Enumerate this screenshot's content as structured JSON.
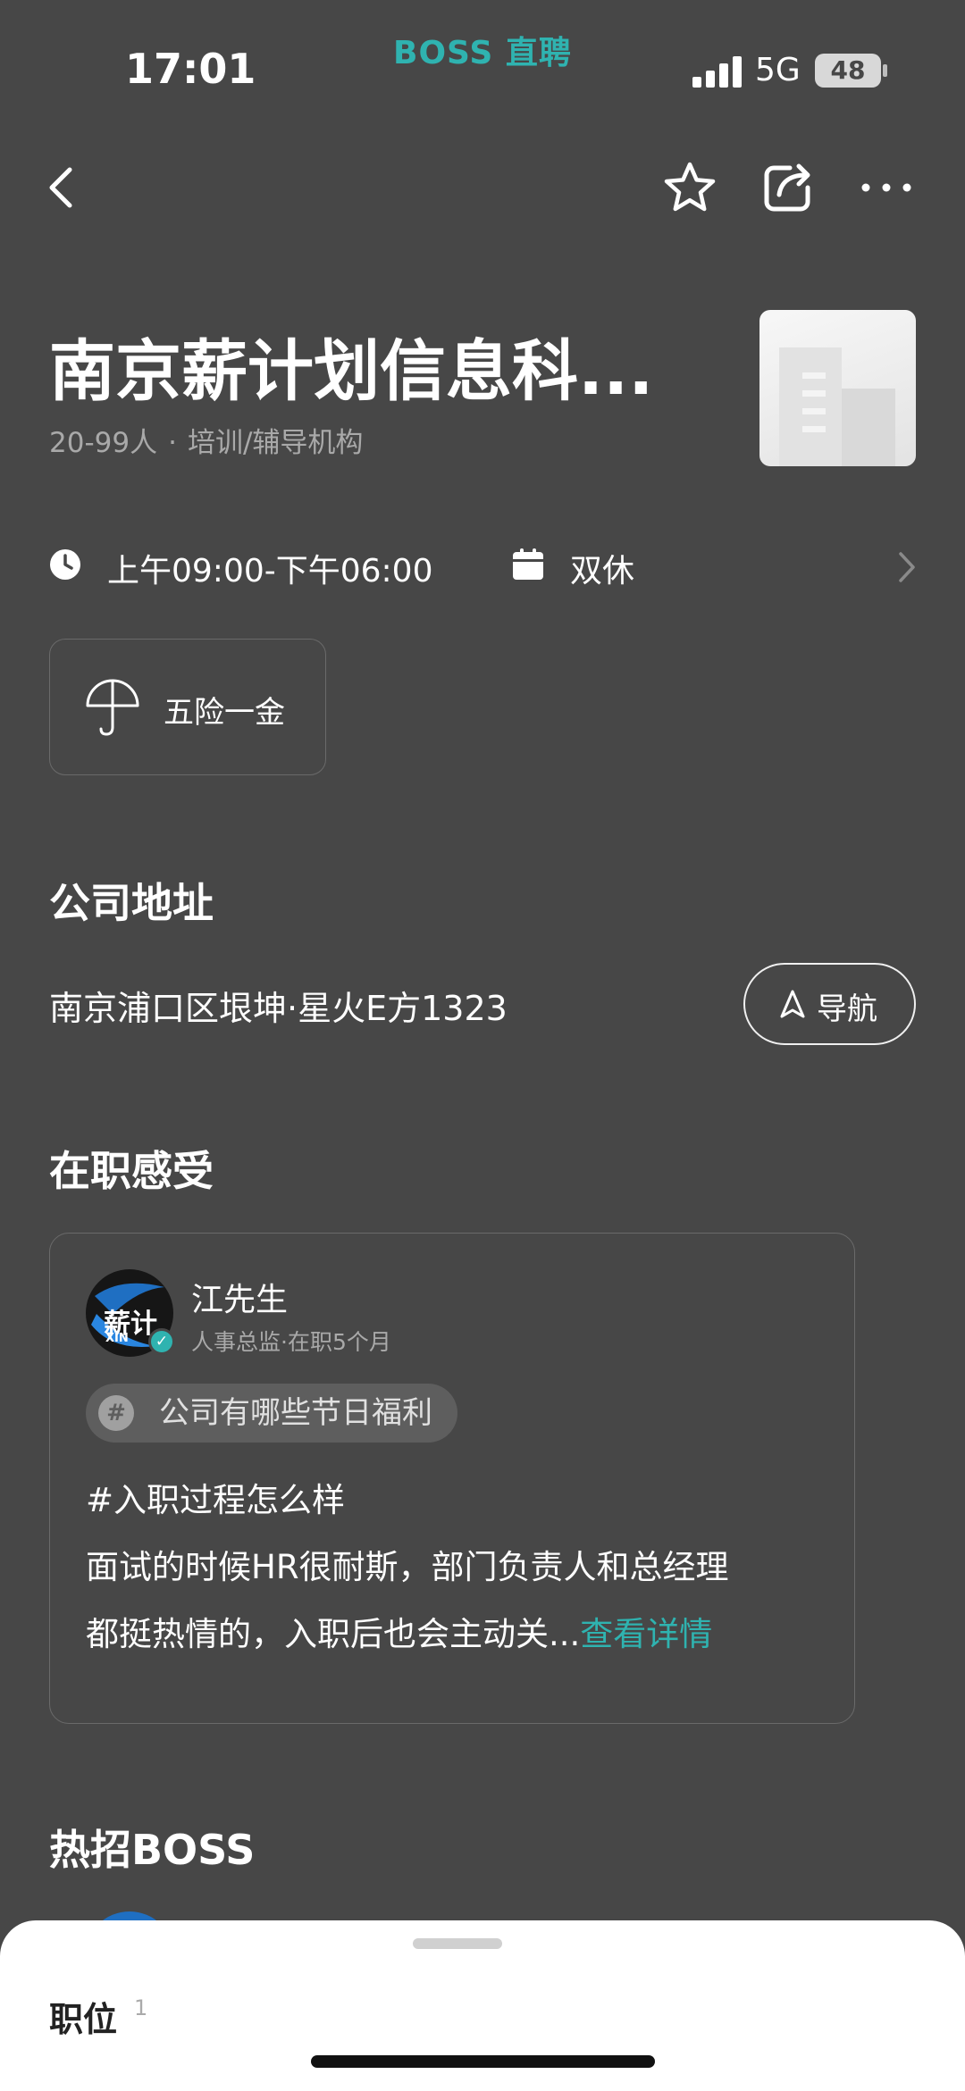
{
  "status_bar": {
    "time": "17:01",
    "app_badge": "BOSS 直聘",
    "network": "5G",
    "battery": "48"
  },
  "nav": {
    "back_icon": "chevron-left-icon",
    "favorite_icon": "star-icon",
    "share_icon": "share-icon",
    "more_icon": "more-icon"
  },
  "company": {
    "name": "南京薪计划信息科...",
    "size": "20-99人",
    "separator": "·",
    "industry": "培训/辅导机构"
  },
  "schedule": {
    "hours": "上午09:00-下午06:00",
    "rest": "双休"
  },
  "benefits": [
    {
      "label": "五险一金",
      "icon": "umbrella-icon"
    }
  ],
  "address_section": {
    "title": "公司地址",
    "address": "南京浦口区垠坤·星火E方1323",
    "nav_button": "导航"
  },
  "reviews_section": {
    "title": "在职感受",
    "review": {
      "avatar_text": "薪计",
      "avatar_sub": "XIN",
      "name": "江先生",
      "role": "人事总监·在职5个月",
      "topic_symbol": "#",
      "topic": "公司有哪些节日福利",
      "line1": "#入职过程怎么样",
      "line2": "面试的时候HR很耐斯，部门负责人和总经理",
      "line3": "都挺热情的，入职后也会主动关...",
      "more_link": "查看详情"
    }
  },
  "hot_boss_section": {
    "title": "热招BOSS"
  },
  "bottom_sheet": {
    "tab_label": "职位",
    "tab_count": "1"
  },
  "colors": {
    "background": "#474747",
    "accent": "#2fb3b0",
    "sheet": "#ffffff"
  }
}
